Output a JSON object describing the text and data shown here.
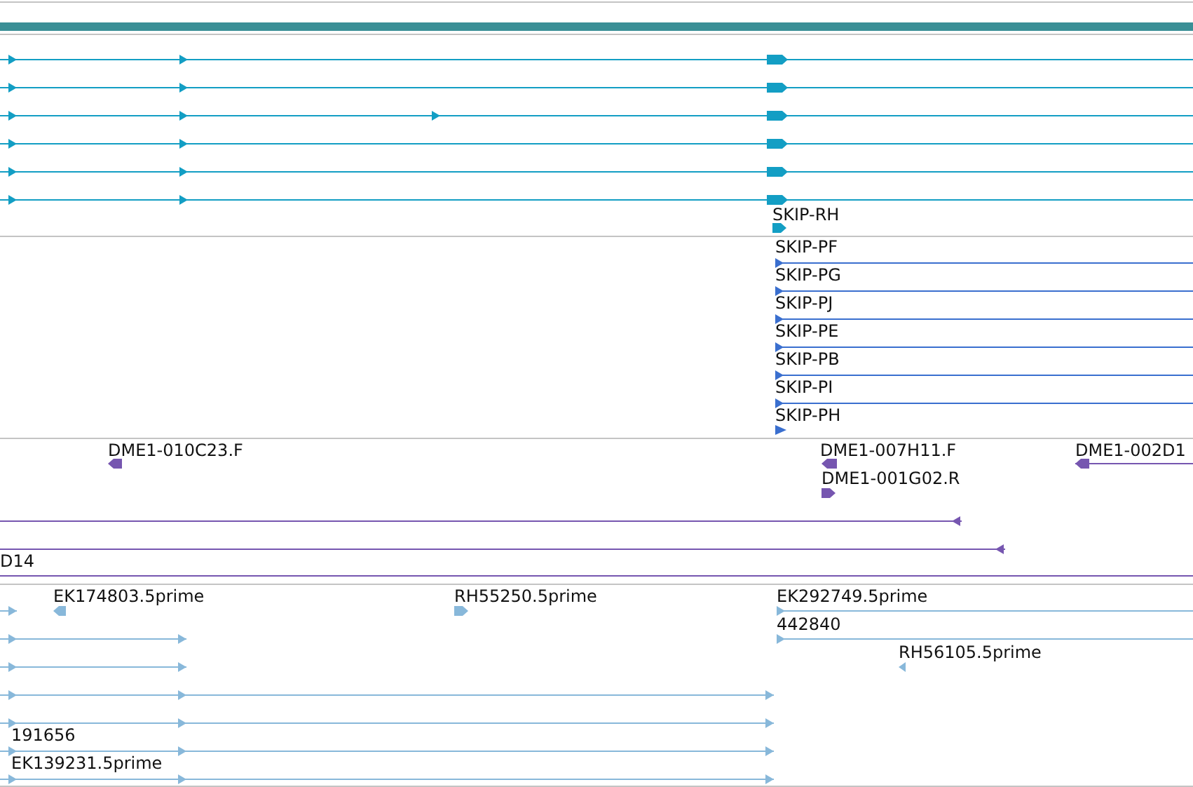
{
  "tracks": [
    {
      "color": "#139ec4",
      "labels": [
        "SKIP-RH"
      ]
    },
    {
      "color": "#3a6fcf",
      "labels": [
        "SKIP-PF",
        "SKIP-PG",
        "SKIP-PJ",
        "SKIP-PE",
        "SKIP-PB",
        "SKIP-PI",
        "SKIP-PH"
      ]
    },
    {
      "color": "#7656b0",
      "labels": [
        "DME1-010C23.F",
        "DME1-007H11.F",
        "DME1-002D1",
        "DME1-001G02.R",
        "D14"
      ]
    },
    {
      "color": "#88b8da",
      "labels": [
        "EK174803.5prime",
        "RH55250.5prime",
        "EK292749.5prime",
        "442840",
        "RH56105.5prime",
        "191656",
        "EK139231.5prime"
      ]
    }
  ]
}
